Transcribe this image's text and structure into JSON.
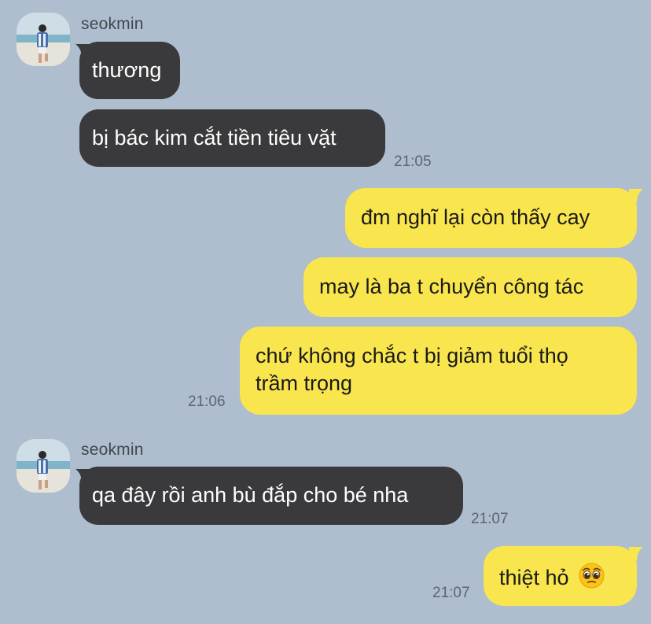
{
  "conversation": {
    "groups": [
      {
        "sender": "seokmin",
        "messages": [
          "thương",
          "bị bác kim cắt tiền tiêu vặt"
        ],
        "time": "21:05"
      },
      {
        "sender": "me",
        "messages": [
          "đm nghĩ lại còn thấy cay",
          "may là ba t chuyển công tác",
          "chứ không chắc t bị giảm tuổi thọ",
          "trầm trọng"
        ],
        "time": "21:06"
      },
      {
        "sender": "seokmin",
        "messages": [
          "qa đây rồi anh bù đắp cho bé nha"
        ],
        "time": "21:07"
      },
      {
        "sender": "me",
        "messages": [
          "thiệt hỏ"
        ],
        "emoji": "pleading-face-emoji",
        "time": "21:07"
      }
    ]
  },
  "colors": {
    "background": "#aebece",
    "incoming_bubble": "#3a3a3c",
    "outgoing_bubble": "#f9e54d",
    "timestamp": "#5b6570"
  }
}
